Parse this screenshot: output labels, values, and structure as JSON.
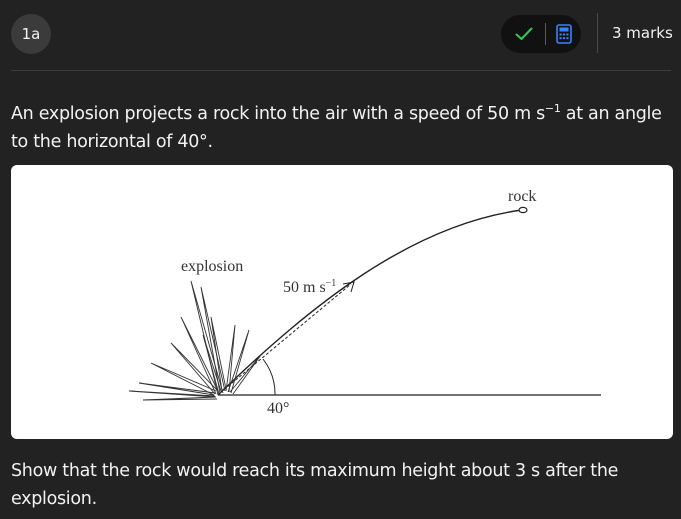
{
  "header": {
    "question_number": "1a",
    "marks": "3 marks",
    "check_icon_color": "#34c759",
    "calculator_icon_color": "#3b82f6"
  },
  "question": {
    "text_before": "An explosion projects a rock into the air with a speed of 50 m s",
    "text_superscript": "−1",
    "text_after": " at an angle to the horizontal of 40°."
  },
  "diagram": {
    "label_rock": "rock",
    "label_explosion": "explosion",
    "label_speed": "50 m s",
    "label_speed_superscript": "−1",
    "label_angle": "40°"
  },
  "followup": {
    "text": "Show that the rock would reach its maximum height about 3 s after the explosion."
  }
}
